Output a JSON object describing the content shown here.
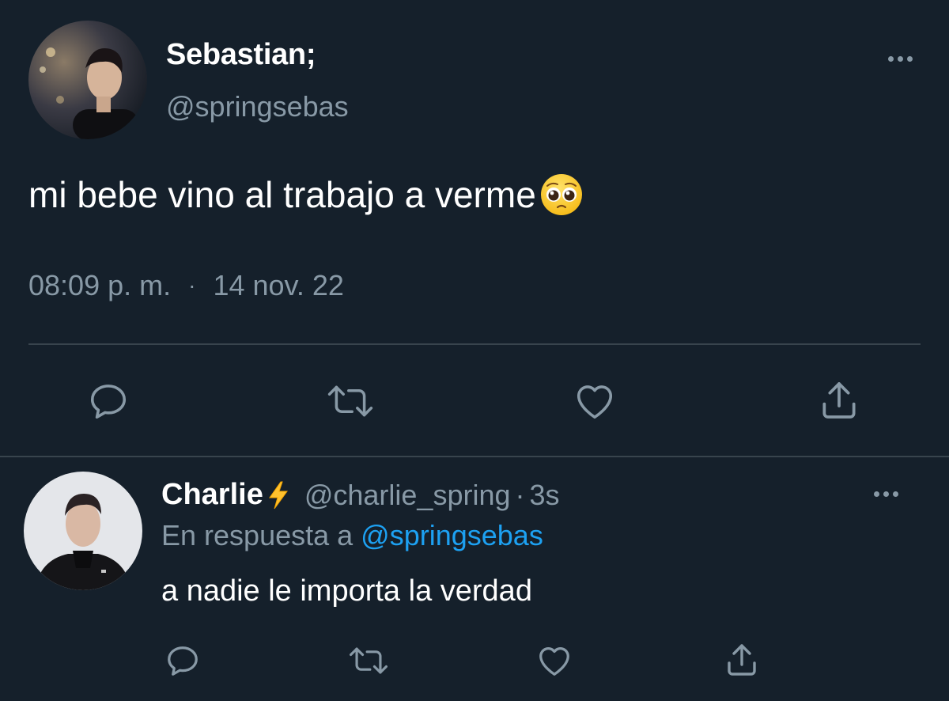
{
  "tweet": {
    "author": {
      "display_name": "Sebastian;",
      "handle": "@springsebas",
      "avatar_icon": "profile-photo"
    },
    "text": "mi bebe vino al trabajo a verme",
    "emoji": "pleading-face",
    "time": "08:09 p. m.",
    "separator": "·",
    "date": "14 nov. 22",
    "more_icon": "more-horizontal-icon",
    "actions": [
      "reply-icon",
      "retweet-icon",
      "like-icon",
      "share-icon"
    ]
  },
  "reply": {
    "author": {
      "display_name": "Charlie",
      "badge_emoji": "high-voltage",
      "handle": "@charlie_spring",
      "avatar_icon": "profile-photo"
    },
    "separator": "·",
    "age": "3s",
    "replying_prefix": "En respuesta a",
    "replying_to": "@springsebas",
    "text": "a nadie le importa la verdad",
    "more_icon": "more-horizontal-icon",
    "actions": [
      "reply-icon",
      "retweet-icon",
      "like-icon",
      "share-icon"
    ]
  },
  "colors": {
    "background": "#15202b",
    "secondary_text": "#8899a6",
    "divider": "#38444d",
    "link": "#1da1f2"
  }
}
